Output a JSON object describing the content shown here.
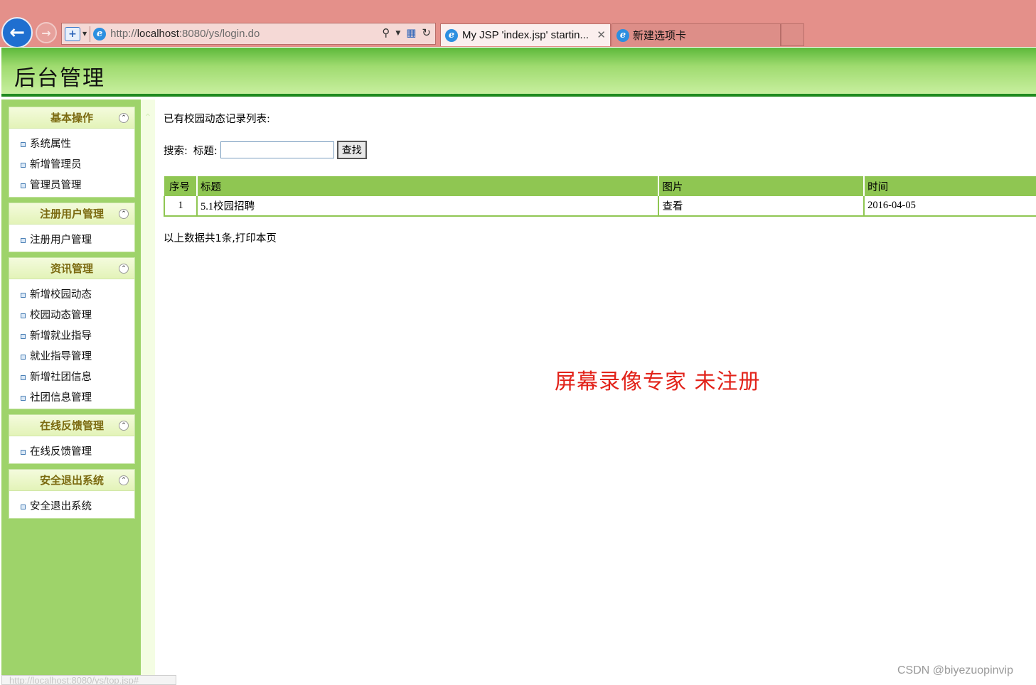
{
  "browser": {
    "url_scheme": "http://",
    "url_host": "localhost",
    "url_rest": ":8080/ys/login.do",
    "tabs": [
      {
        "label": "My JSP 'index.jsp' startin...",
        "active": true
      },
      {
        "label": "新建选项卡",
        "active": false
      }
    ],
    "status_url": "http://localhost:8080/ys/top.jsp#"
  },
  "header": {
    "title": "后台管理"
  },
  "sidebar": {
    "groups": [
      {
        "title": "基本操作",
        "items": [
          "系统属性",
          "新增管理员",
          "管理员管理"
        ]
      },
      {
        "title": "注册用户管理",
        "items": [
          "注册用户管理"
        ]
      },
      {
        "title": "资讯管理",
        "items": [
          "新增校园动态",
          "校园动态管理",
          "新增就业指导",
          "就业指导管理",
          "新增社团信息",
          "社团信息管理"
        ]
      },
      {
        "title": "在线反馈管理",
        "items": [
          "在线反馈管理"
        ]
      },
      {
        "title": "安全退出系统",
        "items": [
          "安全退出系统"
        ]
      }
    ]
  },
  "main": {
    "list_title": "已有校园动态记录列表:",
    "search_label": "搜索:",
    "field_label": "标题:",
    "search_value": "",
    "search_button": "查找",
    "table": {
      "headers": [
        "序号",
        "标题",
        "图片",
        "时间"
      ],
      "rows": [
        {
          "index": "1",
          "title": "5.1校园招聘",
          "image_link": "查看",
          "time": "2016-04-05"
        }
      ]
    },
    "summary_prefix": "以上数据共1条,",
    "print_link": "打印本页"
  },
  "overlay": {
    "watermark": "屏幕录像专家  未注册",
    "credit": "CSDN @biyezuopinvip"
  }
}
